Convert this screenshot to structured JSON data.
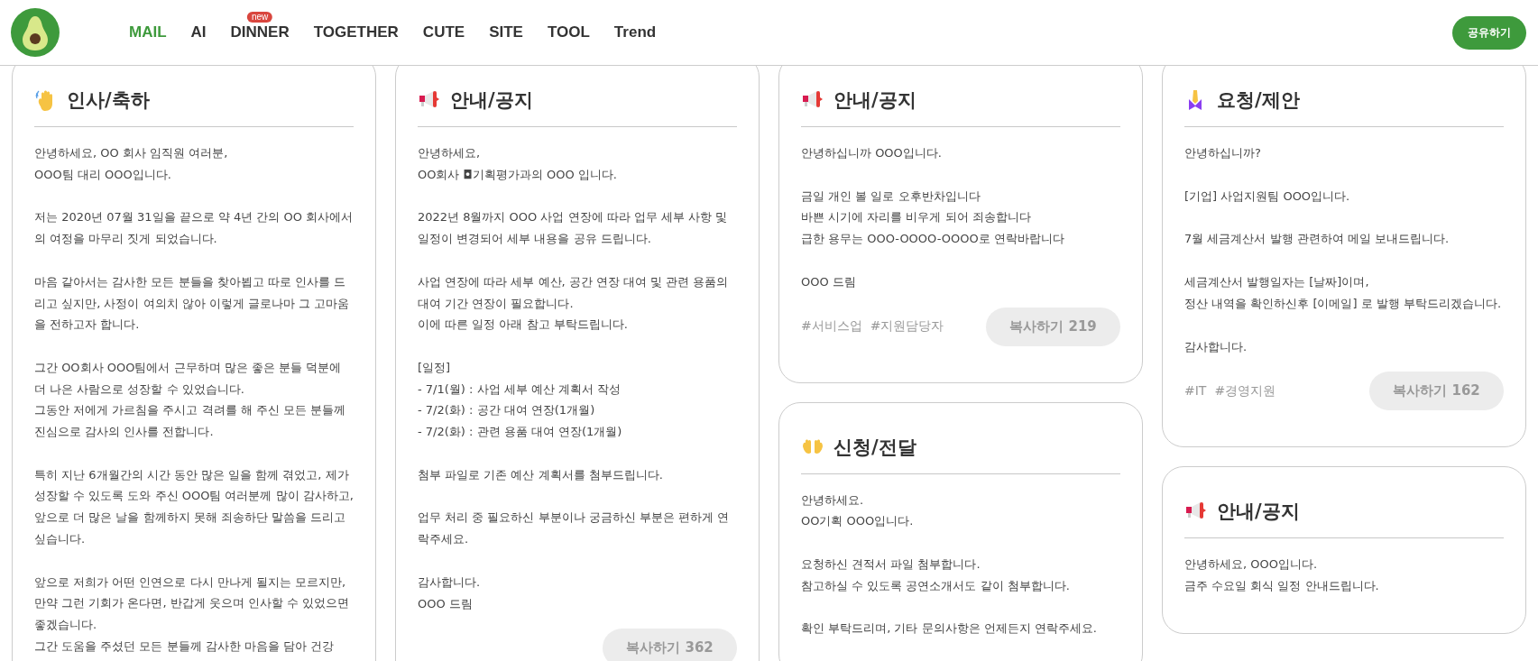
{
  "header": {
    "nav": [
      {
        "label": "MAIL",
        "selected": true
      },
      {
        "label": "AI",
        "selected": false
      },
      {
        "label": "DINNER",
        "selected": false,
        "badge": "new"
      },
      {
        "label": "TOGETHER",
        "selected": false
      },
      {
        "label": "CUTE",
        "selected": false
      },
      {
        "label": "SITE",
        "selected": false
      },
      {
        "label": "TOOL",
        "selected": false
      },
      {
        "label": "Trend",
        "selected": false
      }
    ],
    "share_button": "공유하기"
  },
  "columns": [
    {
      "cards": [
        {
          "kind": "wave",
          "title": "인사/축하",
          "paragraphs": [
            "안녕하세요, OO 회사 임직원 여러분,\nOOO팀 대리 OOO입니다.",
            "저는 2020년 07월 31일을 끝으로 약 4년 간의 OO 회사에서의 여정을 마무리 짓게 되었습니다.",
            "마음 같아서는 감사한 모든 분들을 찾아뵙고 따로 인사를 드리고 싶지만, 사정이 여의치 않아 이렇게 글로나마 그 고마움을 전하고자 합니다.",
            "그간 OO회사 OOO팀에서 근무하며 많은 좋은 분들 덕분에 더 나은 사람으로 성장할 수 있었습니다.\n그동안 저에게 가르침을 주시고 격려를 해 주신 모든 분들께 진심으로 감사의 인사를 전합니다.",
            "특히 지난 6개월간의 시간 동안 많은 일을 함께 겪었고, 제가 성장할 수 있도록 도와 주신 OOO팀 여러분께 많이 감사하고, 앞으로 더 많은 날을 함께하지 못해 죄송하단 말씀을 드리고 싶습니다.",
            "앞으로 저희가 어떤 인연으로 다시 만나게 될지는 모르지만, 만약 그런 기회가 온다면, 반갑게 웃으며 인사할 수 있었으면 좋겠습니다.\n그간 도움을 주셨던 모든 분들께 감사한 마음을 담아 건강"
          ]
        }
      ]
    },
    {
      "cards": [
        {
          "kind": "megaphone",
          "title": "안내/공지",
          "paragraphs": [
            "안녕하세요,\nOO회사 ◘기획평가과의 OOO 입니다.",
            "2022년 8월까지 OOO 사업 연장에 따라 업무 세부 사항 및 일정이 변경되어 세부 내용을 공유 드립니다.",
            "사업 연장에 따라 세부 예산, 공간 연장 대여 및 관련 용품의 대여 기간 연장이 필요합니다.\n이에 따른 일정 아래 참고 부탁드립니다.",
            "[일정]\n- 7/1(월) : 사업 세부 예산 계획서 작성\n- 7/2(화) : 공간 대여 연장(1개월)\n- 7/2(화) : 관련 용품 대여 연장(1개월)",
            "첨부 파일로 기존 예산 계획서를 첨부드립니다.",
            "업무 처리 중 필요하신 부분이나 궁금하신 부분은 편하게 연락주세요.",
            "감사합니다.\nOOO 드림"
          ],
          "copy_button": "복사하기 362"
        }
      ]
    },
    {
      "cards": [
        {
          "kind": "megaphone",
          "title": "안내/공지",
          "paragraphs": [
            "안녕하십니까 OOO입니다.",
            "금일 개인 볼 일로 오후반차입니다\n바쁜 시기에 자리를 비우게 되어 죄송합니다\n급한 용무는 OOO-OOOO-OOOO로 연락바랍니다",
            "OOO 드림"
          ],
          "tags": [
            "#서비스업",
            "#지원담당자"
          ],
          "copy_button": "복사하기 219"
        },
        {
          "kind": "open-hands",
          "title": "신청/전달",
          "paragraphs": [
            "안녕하세요.\nOO기획 OOO입니다.",
            "요청하신 견적서 파일 첨부합니다.\n참고하실 수 있도록 공연소개서도 같이 첨부합니다.",
            "확인 부탁드리며, 기타 문의사항은 언제든지 연락주세요."
          ]
        }
      ]
    },
    {
      "cards": [
        {
          "kind": "praying",
          "title": "요청/제안",
          "paragraphs": [
            "안녕하십니까?",
            "[기업] 사업지원팀 OOO입니다.",
            "7월 세금계산서 발행 관련하여 메일 보내드립니다.",
            "세금계산서 발행일자는 [날짜]이며,\n정산 내역을 확인하신후 [이메일] 로 발행 부탁드리겠습니다.",
            "감사합니다."
          ],
          "tags": [
            "#IT",
            "#경영지원"
          ],
          "copy_button": "복사하기 162"
        },
        {
          "kind": "megaphone",
          "title": "안내/공지",
          "paragraphs": [
            "안녕하세요, OOO입니다.\n금주 수요일 회식 일정 안내드립니다."
          ]
        }
      ]
    }
  ]
}
